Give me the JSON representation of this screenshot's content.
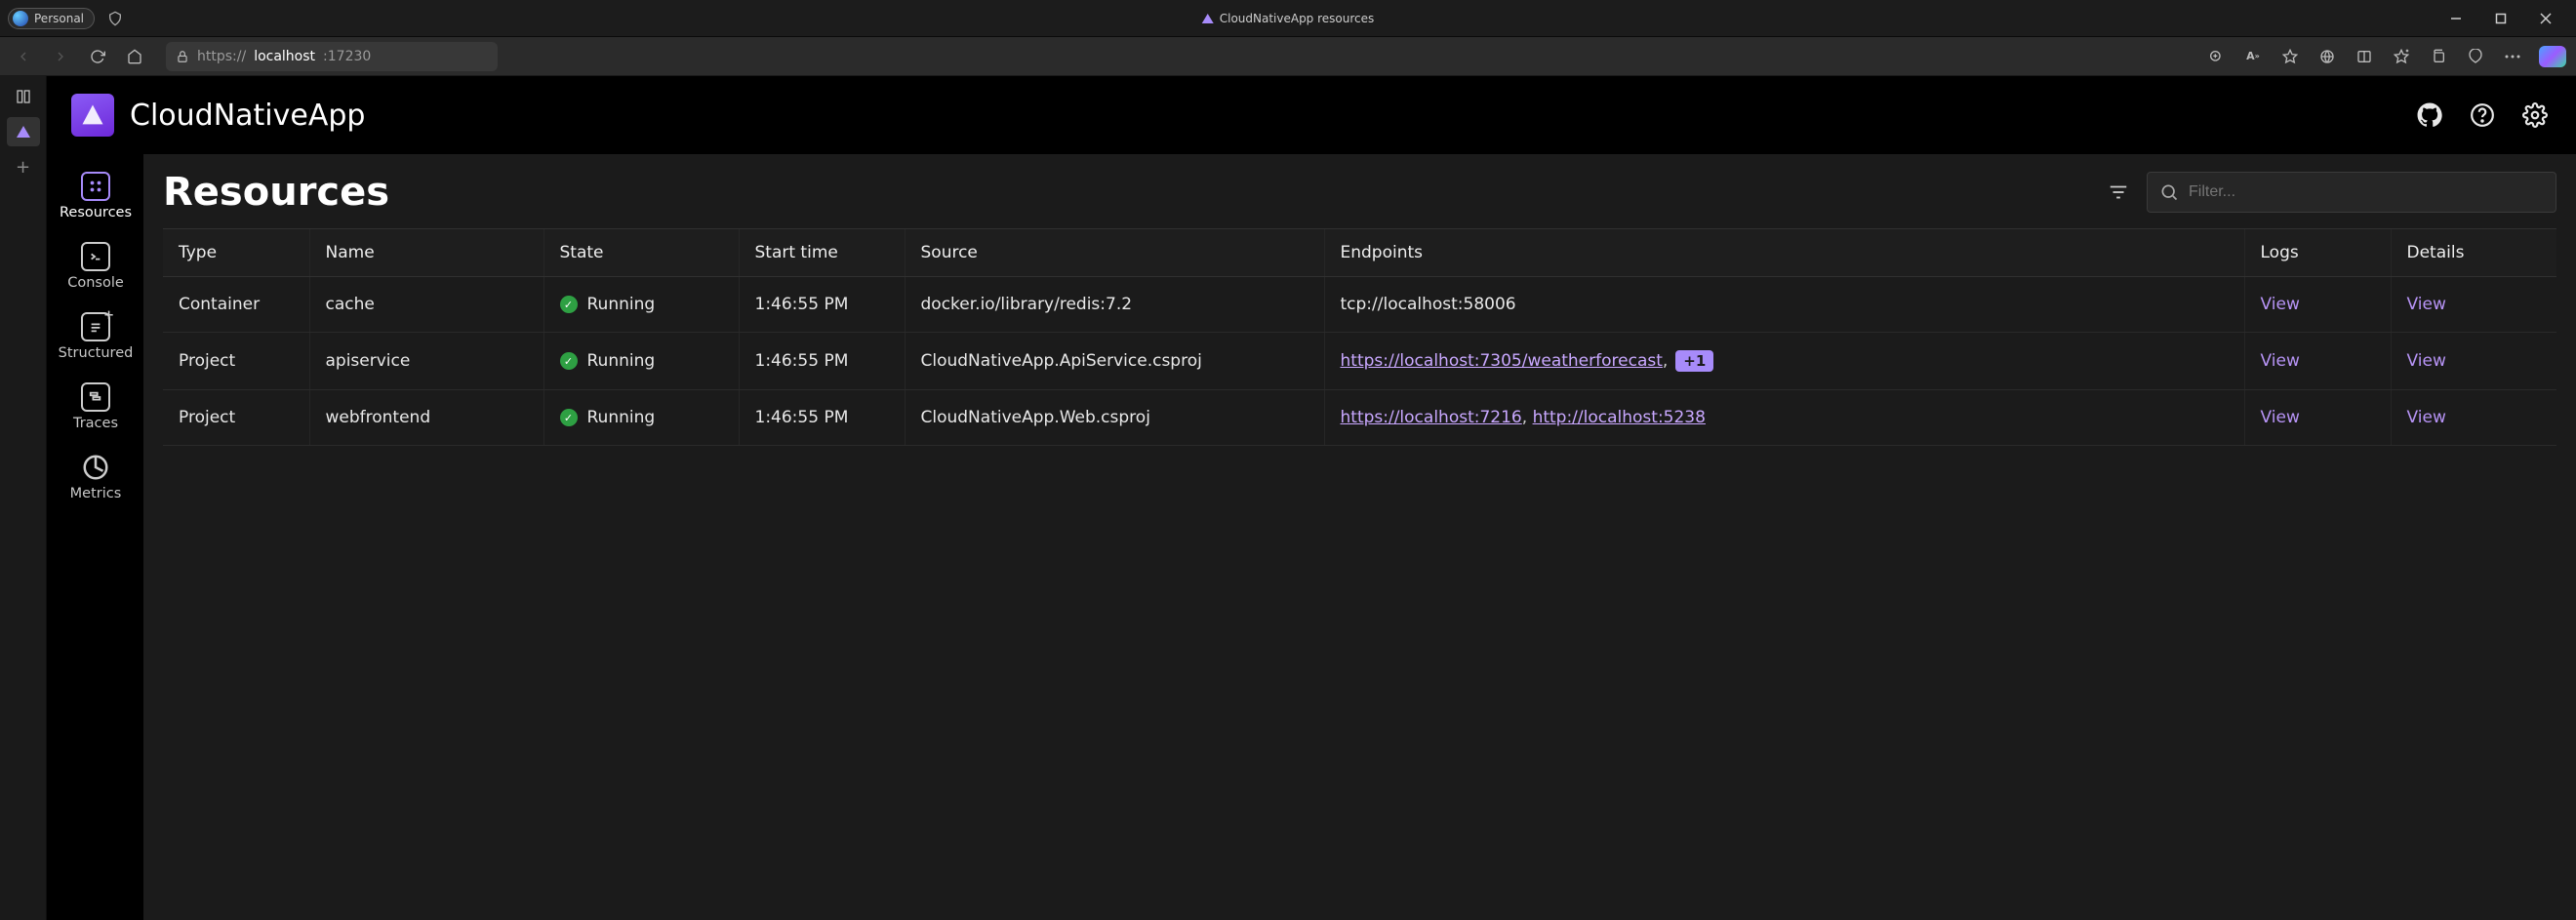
{
  "window": {
    "profile_label": "Personal",
    "tab_title": "CloudNativeApp resources"
  },
  "browser": {
    "url_scheme": "https://",
    "url_host": "localhost",
    "url_port": ":17230"
  },
  "header": {
    "app_name": "CloudNativeApp"
  },
  "sidenav": {
    "items": [
      {
        "label": "Resources"
      },
      {
        "label": "Console"
      },
      {
        "label": "Structured"
      },
      {
        "label": "Traces"
      },
      {
        "label": "Metrics"
      }
    ]
  },
  "page": {
    "title": "Resources",
    "filter_placeholder": "Filter..."
  },
  "table": {
    "columns": {
      "type": "Type",
      "name": "Name",
      "state": "State",
      "start_time": "Start time",
      "source": "Source",
      "endpoints": "Endpoints",
      "logs": "Logs",
      "details": "Details"
    },
    "view_label": "View",
    "rows": [
      {
        "type": "Container",
        "name": "cache",
        "state": "Running",
        "start_time": "1:46:55 PM",
        "source": "docker.io/library/redis:7.2",
        "endpoints": [
          {
            "text": "tcp://localhost:58006",
            "link": false
          }
        ]
      },
      {
        "type": "Project",
        "name": "apiservice",
        "state": "Running",
        "start_time": "1:46:55 PM",
        "source": "CloudNativeApp.ApiService.csproj",
        "endpoints": [
          {
            "text": "https://localhost:7305/weatherforecast",
            "link": true
          }
        ],
        "extra_badge": "+1"
      },
      {
        "type": "Project",
        "name": "webfrontend",
        "state": "Running",
        "start_time": "1:46:55 PM",
        "source": "CloudNativeApp.Web.csproj",
        "endpoints": [
          {
            "text": "https://localhost:7216",
            "link": true
          },
          {
            "text": "http://localhost:5238",
            "link": true
          }
        ]
      }
    ]
  }
}
